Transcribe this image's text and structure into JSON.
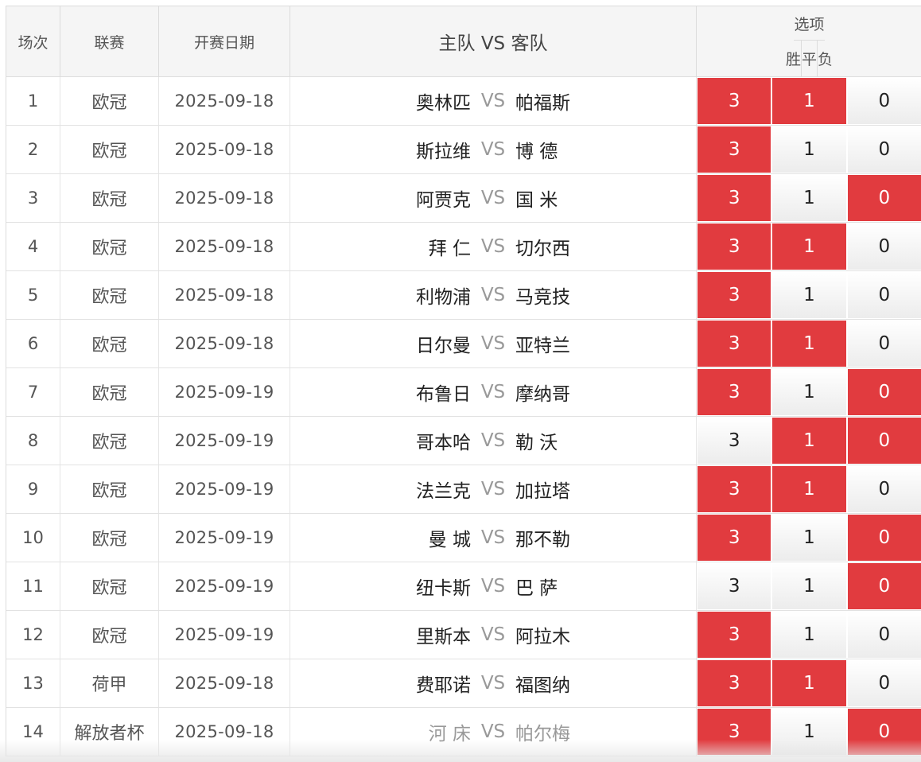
{
  "header": {
    "col_no": "场次",
    "col_league": "联赛",
    "col_date": "开赛日期",
    "col_match": "主队 VS 客队",
    "col_options": "选项",
    "opt_win": "胜",
    "opt_draw": "平",
    "opt_lose": "负"
  },
  "vs_label": "VS",
  "option_values": {
    "win": "3",
    "draw": "1",
    "lose": "0"
  },
  "colors": {
    "selected": "#e13b3f",
    "selected_text": "#ffffff"
  },
  "rows": [
    {
      "no": "1",
      "league": "欧冠",
      "date": "2025-09-18",
      "home": "奥林匹",
      "away": "帕福斯",
      "win": true,
      "draw": true,
      "lose": false
    },
    {
      "no": "2",
      "league": "欧冠",
      "date": "2025-09-18",
      "home": "斯拉维",
      "away": "博 德",
      "win": true,
      "draw": false,
      "lose": false
    },
    {
      "no": "3",
      "league": "欧冠",
      "date": "2025-09-18",
      "home": "阿贾克",
      "away": "国 米",
      "win": true,
      "draw": false,
      "lose": true
    },
    {
      "no": "4",
      "league": "欧冠",
      "date": "2025-09-18",
      "home": "拜 仁",
      "away": "切尔西",
      "win": true,
      "draw": true,
      "lose": false
    },
    {
      "no": "5",
      "league": "欧冠",
      "date": "2025-09-18",
      "home": "利物浦",
      "away": "马竞技",
      "win": true,
      "draw": false,
      "lose": false
    },
    {
      "no": "6",
      "league": "欧冠",
      "date": "2025-09-18",
      "home": "日尔曼",
      "away": "亚特兰",
      "win": true,
      "draw": true,
      "lose": false
    },
    {
      "no": "7",
      "league": "欧冠",
      "date": "2025-09-19",
      "home": "布鲁日",
      "away": "摩纳哥",
      "win": true,
      "draw": false,
      "lose": true
    },
    {
      "no": "8",
      "league": "欧冠",
      "date": "2025-09-19",
      "home": "哥本哈",
      "away": "勒 沃",
      "win": false,
      "draw": true,
      "lose": true
    },
    {
      "no": "9",
      "league": "欧冠",
      "date": "2025-09-19",
      "home": "法兰克",
      "away": "加拉塔",
      "win": true,
      "draw": true,
      "lose": false
    },
    {
      "no": "10",
      "league": "欧冠",
      "date": "2025-09-19",
      "home": "曼 城",
      "away": "那不勒",
      "win": true,
      "draw": false,
      "lose": true
    },
    {
      "no": "11",
      "league": "欧冠",
      "date": "2025-09-19",
      "home": "纽卡斯",
      "away": "巴 萨",
      "win": false,
      "draw": false,
      "lose": true
    },
    {
      "no": "12",
      "league": "欧冠",
      "date": "2025-09-19",
      "home": "里斯本",
      "away": "阿拉木",
      "win": true,
      "draw": false,
      "lose": false
    },
    {
      "no": "13",
      "league": "荷甲",
      "date": "2025-09-18",
      "home": "费耶诺",
      "away": "福图纳",
      "win": true,
      "draw": true,
      "lose": false
    },
    {
      "no": "14",
      "league": "解放者杯",
      "date": "2025-09-18",
      "home": "河 床",
      "away": "帕尔梅",
      "win": true,
      "draw": false,
      "lose": true,
      "muted": true
    }
  ]
}
